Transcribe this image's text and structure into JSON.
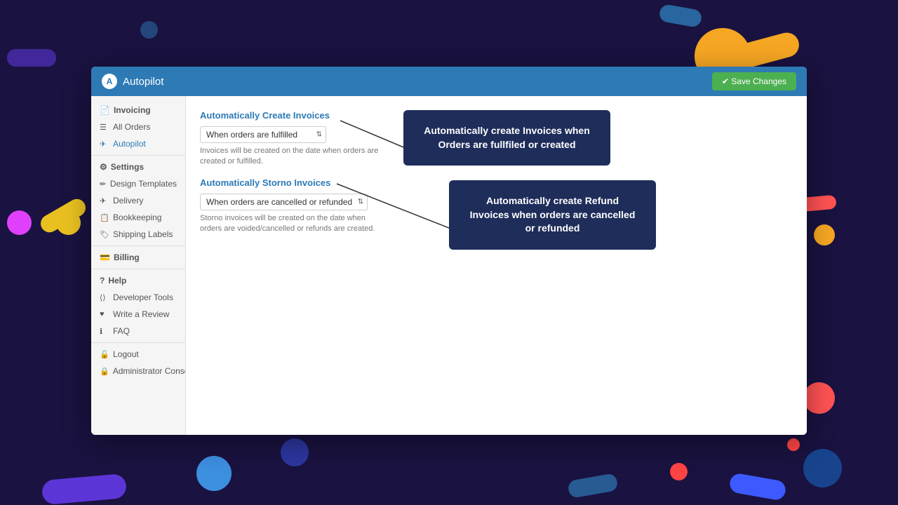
{
  "header": {
    "logo_text": "A",
    "title": "Autopilot",
    "save_button": "✔ Save Changes"
  },
  "sidebar": {
    "sections": [
      {
        "label": "Invoicing",
        "icon": "📄",
        "items": [
          {
            "id": "all-orders",
            "label": "All Orders",
            "icon": "☰",
            "active": false
          },
          {
            "id": "autopilot",
            "label": "Autopilot",
            "icon": "✈",
            "active": true
          }
        ]
      },
      {
        "label": "Settings",
        "icon": "⚙",
        "items": [
          {
            "id": "design-templates",
            "label": "Design Templates",
            "icon": "✏"
          },
          {
            "id": "delivery",
            "label": "Delivery",
            "icon": "✈"
          },
          {
            "id": "bookkeeping",
            "label": "Bookkeeping",
            "icon": "📋"
          },
          {
            "id": "shipping-labels",
            "label": "Shipping Labels",
            "icon": "🏷"
          }
        ]
      },
      {
        "label": "Billing",
        "icon": "💳",
        "items": []
      },
      {
        "label": "Help",
        "icon": "?",
        "items": [
          {
            "id": "developer-tools",
            "label": "Developer Tools",
            "icon": "⟨⟩"
          },
          {
            "id": "write-review",
            "label": "Write a Review",
            "icon": "♥"
          },
          {
            "id": "faq",
            "label": "FAQ",
            "icon": "ℹ"
          }
        ]
      },
      {
        "label": "",
        "items": [
          {
            "id": "logout",
            "label": "Logout",
            "icon": "🔓"
          },
          {
            "id": "admin-console",
            "label": "Administrator Console",
            "icon": "🔒"
          }
        ]
      }
    ]
  },
  "main": {
    "auto_create_invoices": {
      "section_title": "Automatically Create Invoices",
      "select_label": "When orders are fulfilled",
      "select_value": "When orders are fulfilled",
      "description": "Invoices will be created on the date when orders are created or fulfilled."
    },
    "auto_storno_invoices": {
      "section_title": "Automatically Storno Invoices",
      "select_label": "When orders are cancelled or refunded",
      "select_value": "When orders are cancelled or refunded",
      "description": "Storno invoices will be created on the date when orders are voided/cancelled or refunds are created."
    }
  },
  "tooltips": {
    "tooltip1": {
      "text": "Automatically create Invoices when Orders are fullfiled or created"
    },
    "tooltip2": {
      "text": "Automatically create Refund Invoices when orders are cancelled or refunded"
    }
  }
}
